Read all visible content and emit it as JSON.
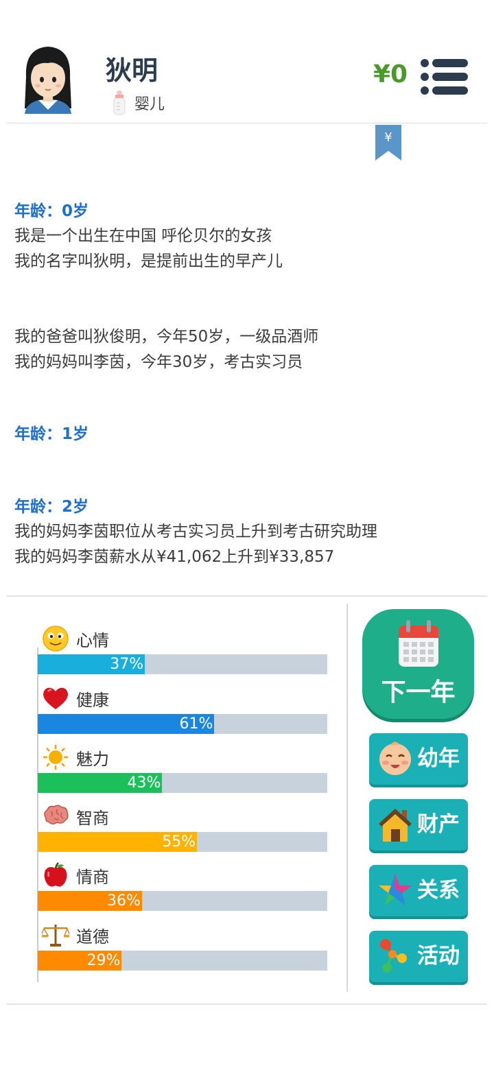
{
  "profile": {
    "name": "狄明",
    "stage": "婴儿",
    "money": "¥0"
  },
  "log": [
    {
      "age": "年龄：0岁",
      "lines": [
        "我是一个出生在中国 呼伦贝尔的女孩",
        "我的名字叫狄明，是提前出生的早产儿"
      ]
    },
    {
      "age": "",
      "lines": [
        "我的爸爸叫狄俊明，今年50岁，一级品酒师",
        "我的妈妈叫李茵，今年30岁，考古实习员"
      ]
    },
    {
      "age": "年龄：1岁",
      "lines": []
    },
    {
      "age": "年龄：2岁",
      "lines": [
        "我的妈妈李茵职位从考古实习员上升到考古研究助理",
        "我的妈妈李茵薪水从¥41,062上升到¥33,857"
      ]
    }
  ],
  "stats": [
    {
      "name": "心情",
      "value": 37,
      "label": "37%",
      "color": "#1aaedc",
      "icon": "smiley-icon"
    },
    {
      "name": "健康",
      "value": 61,
      "label": "61%",
      "color": "#1a86e0",
      "icon": "heart-icon"
    },
    {
      "name": "魅力",
      "value": 43,
      "label": "43%",
      "color": "#1cc05a",
      "icon": "sun-icon"
    },
    {
      "name": "智商",
      "value": 55,
      "label": "55%",
      "color": "#ffb300",
      "icon": "brain-icon"
    },
    {
      "name": "情商",
      "value": 36,
      "label": "36%",
      "color": "#ff8a00",
      "icon": "apple-icon"
    },
    {
      "name": "道德",
      "value": 29,
      "label": "29%",
      "color": "#ff8a00",
      "icon": "scale-icon"
    }
  ],
  "buttons": {
    "next_year": "下一年",
    "childhood": "幼年",
    "assets": "财产",
    "relations": "关系",
    "activities": "活动"
  }
}
